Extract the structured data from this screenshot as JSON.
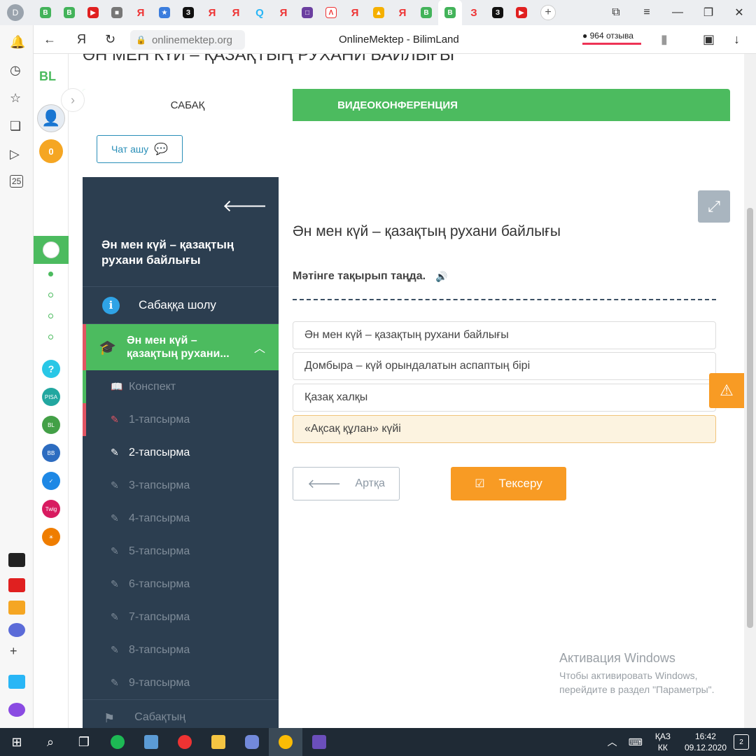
{
  "browser": {
    "profile_letter": "D",
    "url": "onlinemektep.org",
    "page_title": "OnlineMektep - BilimLand",
    "reviews": "964 отзыва",
    "ya_label": "Я",
    "tab_labels": [
      "Я",
      "З",
      "Я",
      "Я",
      "Я",
      "Я",
      "Я",
      "З"
    ]
  },
  "bl_sidebar": {
    "logo": "BL",
    "points": "0"
  },
  "lesson": {
    "header": "ӘН МЕН КҮЙ – ҚАЗАҚТЫҢ РУХАНИ БАЙЛЫҒЫ",
    "tab_lesson": "САБАҚ",
    "tab_video": "ВИДЕОКОНФЕРЕНЦИЯ",
    "chat_button": "Чат ашу"
  },
  "sidebar": {
    "title": "Ән мен күй – қазақтың рухани байлығы",
    "review_item": "Сабаққа шолу",
    "active_lesson": "Ән мен күй – қазақтың рухани...",
    "items": [
      {
        "label": "Конспект",
        "state": "done"
      },
      {
        "label": "1-тапсырма",
        "state": "err"
      },
      {
        "label": "2-тапсырма",
        "state": "cur"
      },
      {
        "label": "3-тапсырма",
        "state": "none"
      },
      {
        "label": "4-тапсырма",
        "state": "none"
      },
      {
        "label": "5-тапсырма",
        "state": "none"
      },
      {
        "label": "6-тапсырма",
        "state": "none"
      },
      {
        "label": "7-тапсырма",
        "state": "none"
      },
      {
        "label": "8-тапсырма",
        "state": "none"
      },
      {
        "label": "9-тапсырма",
        "state": "none"
      }
    ],
    "final_item": "Сабақтың"
  },
  "task": {
    "title": "Ән мен күй – қазақтың рухани байлығы",
    "question": "Мәтінге тақырып таңда.",
    "options": [
      "Ән мен күй – қазақтың рухани байлығы",
      "Домбыра – күй орындалатын аспаптың бірі",
      "Қазақ халқы",
      "«Ақсақ құлан» күйі"
    ],
    "selected_index": 3,
    "back_button": "Артқа",
    "check_button": "Тексеру"
  },
  "watermark": {
    "heading": "Активация Windows",
    "line1": "Чтобы активировать Windows,",
    "line2": "перейдите в раздел \"Параметры\"."
  },
  "taskbar": {
    "lang_top": "ҚАЗ",
    "lang_bottom": "КК",
    "time": "16:42",
    "date": "09.12.2020",
    "notifications": "2"
  },
  "colors": {
    "green": "#4cbb5f",
    "sidebar": "#2c3e50",
    "orange": "#f89b24",
    "red": "#e25563"
  }
}
